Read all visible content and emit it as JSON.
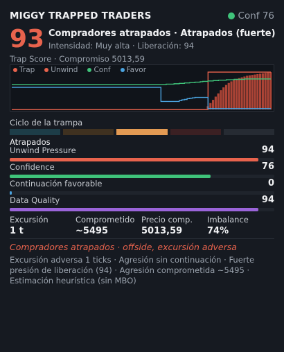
{
  "header": {
    "title": "MIGGY TRAPPED TRADERS",
    "conf": "Conf 76"
  },
  "summary": {
    "score": "93",
    "headline": "Compradores atrapados  ·  Atrapados (fuerte)",
    "subline": "Intensidad: Muy alta  ·  Liberación: 94",
    "trap_line": "Trap Score  ·  Compromiso 5013,59"
  },
  "legend": [
    {
      "label": "Trap",
      "color": "#e8634d"
    },
    {
      "label": "Unwind",
      "color": "#e8634d"
    },
    {
      "label": "Conf",
      "color": "#3fc37a"
    },
    {
      "label": "Favor",
      "color": "#4aa3df"
    }
  ],
  "chart_data": {
    "type": "line",
    "series": [
      {
        "name": "Trap",
        "color": "#e8634d",
        "values": [
          0,
          0,
          0,
          0,
          0,
          0,
          0,
          0,
          0,
          0,
          0,
          0,
          0,
          0,
          0,
          0,
          0,
          0,
          0,
          0,
          0,
          0,
          0,
          0,
          0,
          0,
          0,
          0,
          0,
          0,
          0,
          0,
          0,
          0,
          0,
          0,
          0,
          0,
          0,
          0,
          0,
          0,
          0,
          0,
          0,
          0,
          0,
          0,
          0,
          0,
          0,
          0,
          0,
          0,
          0,
          0,
          0,
          0,
          0,
          0,
          0,
          0,
          0,
          0,
          0,
          0,
          0,
          0,
          0,
          0,
          0,
          0,
          0,
          0,
          0,
          93,
          93,
          93,
          93,
          93,
          93,
          93,
          93,
          93,
          93,
          93,
          93,
          93,
          93,
          93,
          93,
          93,
          93,
          93,
          93,
          93,
          93,
          93,
          93,
          93
        ]
      },
      {
        "name": "Unwind",
        "color": "#e8634d",
        "values": [
          0,
          0,
          0,
          0,
          0,
          0,
          0,
          0,
          0,
          0,
          0,
          0,
          0,
          0,
          0,
          0,
          0,
          0,
          0,
          0,
          0,
          0,
          0,
          0,
          0,
          0,
          0,
          0,
          0,
          0,
          0,
          0,
          0,
          0,
          0,
          0,
          0,
          0,
          0,
          0,
          0,
          0,
          0,
          0,
          0,
          0,
          0,
          0,
          0,
          0,
          0,
          0,
          0,
          0,
          0,
          0,
          0,
          0,
          0,
          0,
          0,
          0,
          0,
          0,
          0,
          0,
          0,
          0,
          0,
          0,
          0,
          0,
          0,
          0,
          0,
          8,
          16,
          24,
          32,
          40,
          48,
          55,
          61,
          66,
          70,
          73,
          76,
          78,
          80,
          82,
          84,
          85,
          86,
          87,
          88,
          89,
          90,
          91,
          92,
          93
        ]
      },
      {
        "name": "Conf",
        "color": "#3fc37a",
        "values": [
          62,
          62,
          62,
          62,
          62,
          62,
          62,
          62,
          62,
          62,
          62,
          62,
          62,
          62,
          62,
          62,
          62,
          62,
          62,
          62,
          62,
          62,
          62,
          62,
          62,
          62,
          62,
          62,
          62,
          62,
          62,
          62,
          62,
          62,
          62,
          62,
          62,
          62,
          62,
          62,
          62,
          62,
          62,
          62,
          62,
          62,
          62,
          62,
          62,
          62,
          62,
          62,
          62,
          62,
          62,
          62,
          62,
          62,
          62,
          63,
          63,
          63,
          64,
          64,
          65,
          65,
          66,
          66,
          67,
          67,
          68,
          68,
          69,
          70,
          70,
          71,
          71,
          72,
          72,
          73,
          73,
          73,
          74,
          74,
          74,
          75,
          75,
          75,
          75,
          76,
          76,
          76,
          76,
          76,
          76,
          76,
          76,
          76,
          76,
          76
        ]
      },
      {
        "name": "Favor",
        "color": "#4aa3df",
        "values": [
          55,
          55,
          55,
          55,
          55,
          55,
          55,
          55,
          55,
          55,
          55,
          55,
          55,
          55,
          55,
          55,
          55,
          55,
          55,
          55,
          55,
          55,
          55,
          55,
          55,
          55,
          55,
          55,
          55,
          55,
          55,
          55,
          55,
          55,
          55,
          55,
          55,
          55,
          55,
          55,
          55,
          55,
          55,
          55,
          55,
          55,
          55,
          55,
          55,
          55,
          55,
          55,
          55,
          55,
          55,
          55,
          55,
          20,
          20,
          20,
          20,
          20,
          20,
          20,
          22,
          24,
          25,
          27,
          28,
          29,
          30,
          30,
          30,
          30,
          30,
          2,
          2,
          2,
          2,
          2,
          2,
          2,
          2,
          2,
          2,
          2,
          2,
          2,
          2,
          2,
          2,
          2,
          2,
          2,
          2,
          2,
          2,
          2,
          2,
          2
        ]
      }
    ],
    "ylim": [
      0,
      100
    ],
    "grid": false,
    "legend_position": "top-left"
  },
  "cycle": {
    "label": "Ciclo de la trampa",
    "segments": [
      {
        "color": "#1d3d48"
      },
      {
        "color": "#3f3120"
      },
      {
        "color": "#e39a53"
      },
      {
        "color": "#3b2023"
      },
      {
        "color": "#262b33"
      }
    ]
  },
  "state_label": "Atrapados",
  "metrics": [
    {
      "name": "Unwind Pressure",
      "value": "94",
      "fraction": 0.94,
      "color": "#e8634d"
    },
    {
      "name": "Confidence",
      "value": "76",
      "fraction": 0.76,
      "color": "#3fc37a"
    },
    {
      "name": "Continuación favorable",
      "value": "0",
      "fraction": 0.0,
      "color": "#4aa3df"
    },
    {
      "name": "Data Quality",
      "value": "94",
      "fraction": 0.94,
      "color": "#9a64d9"
    }
  ],
  "stats": [
    {
      "label": "Excursión",
      "value": "1 t"
    },
    {
      "label": "Comprometido",
      "value": "~5495"
    },
    {
      "label": "Precio comp.",
      "value": "5013,59"
    },
    {
      "label": "Imbalance",
      "value": "74%"
    }
  ],
  "alert": "Compradores atrapados · offside, excursión adversa",
  "notes": "Excursión adversa 1 ticks  ·  Agresión sin continuación  ·  Fuerte presión de liberación (94)  ·  Agresión comprometida ~5495  ·  Estimación heurística (sin MBO)"
}
